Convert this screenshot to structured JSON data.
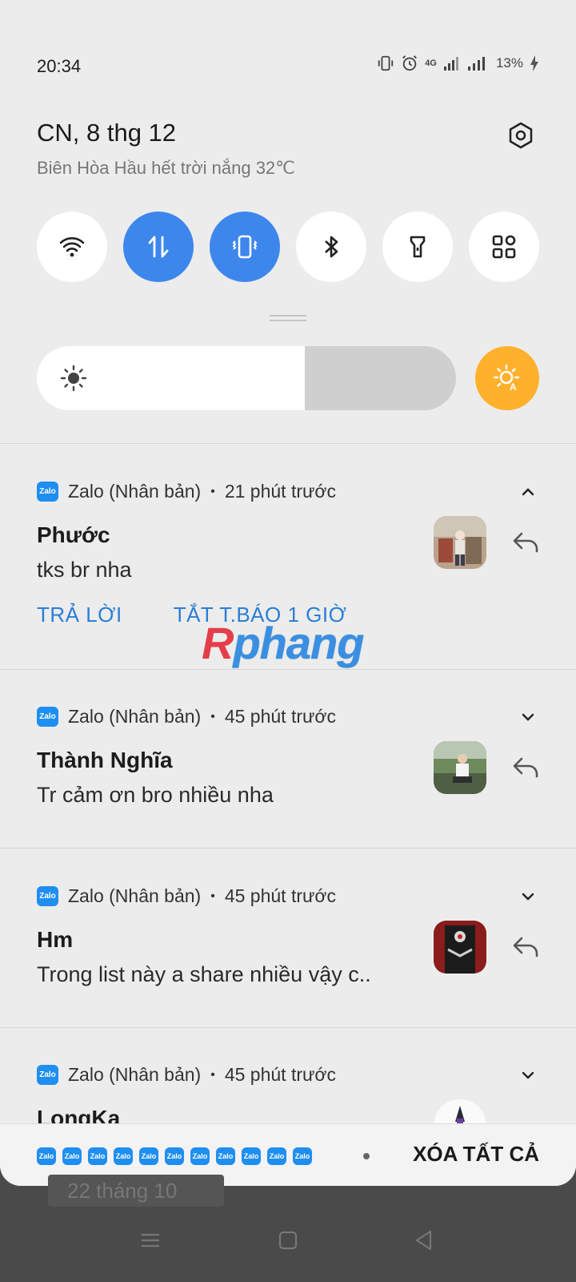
{
  "status_bar": {
    "time": "20:34",
    "battery_percent": "13%",
    "network": "4G"
  },
  "header": {
    "date": "CN, 8 thg 12",
    "weather": "Biên Hòa Hầu hết trời nắng 32℃"
  },
  "quick_tiles": [
    {
      "name": "wifi",
      "active": false
    },
    {
      "name": "mobile-data",
      "active": true
    },
    {
      "name": "vibrate",
      "active": true
    },
    {
      "name": "bluetooth",
      "active": false
    },
    {
      "name": "flashlight",
      "active": false
    },
    {
      "name": "more-tiles",
      "active": false
    }
  ],
  "brightness": {
    "level": 0.64,
    "auto": true
  },
  "notifications": [
    {
      "app": "Zalo (Nhân bản)",
      "time": "21 phút trước",
      "sender": "Phước",
      "message": "tks br nha",
      "expanded": true,
      "actions": [
        "TRẢ LỜI",
        "TẮT T.BÁO 1 GIỜ"
      ]
    },
    {
      "app": "Zalo (Nhân bản)",
      "time": "45 phút trước",
      "sender": "Thành Nghĩa",
      "message": "Tr cảm ơn bro nhiều nha",
      "expanded": false
    },
    {
      "app": "Zalo (Nhân bản)",
      "time": "45 phút trước",
      "sender": "Hm",
      "message": "Trong list này a share nhiều vậy c..",
      "expanded": false
    },
    {
      "app": "Zalo (Nhân bản)",
      "time": "45 phút trước",
      "sender": "LongKa",
      "message": "",
      "expanded": false
    }
  ],
  "zalo_icon_text": "Zalo",
  "dot_separator": "•",
  "watermark": {
    "left": "R",
    "right": "phang"
  },
  "footer": {
    "clear_all": "XÓA TẤT CẢ",
    "app_icon_count": 11
  },
  "behind_text": "22 tháng 10"
}
